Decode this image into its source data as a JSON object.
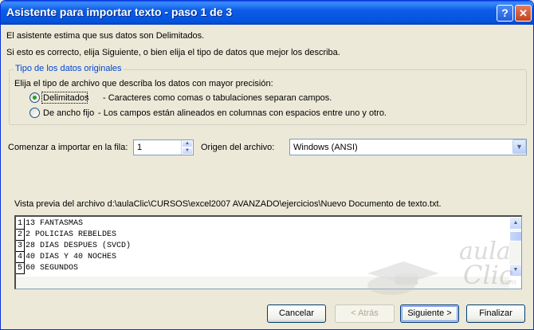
{
  "window": {
    "title": "Asistente para importar texto - paso 1 de 3",
    "help_label": "?",
    "close_label": "✕"
  },
  "intro": {
    "line1": "El asistente estima que sus datos son Delimitados.",
    "line2": "Si esto es correcto, elija Siguiente, o bien elija el tipo de datos que mejor los describa."
  },
  "group": {
    "legend": "Tipo de los datos originales",
    "instruction": "Elija el tipo de archivo que describa los datos con mayor precisión:",
    "options": [
      {
        "label": "Delimitados",
        "description": "- Caracteres como comas o tabulaciones separan campos.",
        "selected": true
      },
      {
        "label": "De ancho fijo",
        "description": "- Los campos están alineados en columnas con espacios entre uno y otro.",
        "selected": false
      }
    ]
  },
  "import_row": {
    "label": "Comenzar a importar en la fila:",
    "value": "1"
  },
  "origin": {
    "label": "Origen del archivo:",
    "value": "Windows (ANSI)"
  },
  "preview": {
    "label": "Vista previa del archivo d:\\aulaClic\\CURSOS\\excel2007 AVANZADO\\ejercicios\\Nuevo Documento de texto.txt.",
    "rows": [
      {
        "num": "1",
        "text": "13 FANTASMAS"
      },
      {
        "num": "2",
        "text": "2 POLICIAS REBELDES"
      },
      {
        "num": "3",
        "text": "28 DIAS DESPUES (SVCD)"
      },
      {
        "num": "4",
        "text": "40 DIAS Y 40 NOCHES"
      },
      {
        "num": "5",
        "text": "60 SEGUNDOS"
      }
    ]
  },
  "logo": {
    "word1": "aula",
    "word2": "Clic",
    "suffix": ".com"
  },
  "buttons": {
    "cancel": "Cancelar",
    "back": "< Atrás",
    "next": "Siguiente >",
    "finish": "Finalizar"
  },
  "colors": {
    "accent": "#0046d5",
    "titlebar": "#0453dd",
    "radio_dot": "#21a121"
  }
}
